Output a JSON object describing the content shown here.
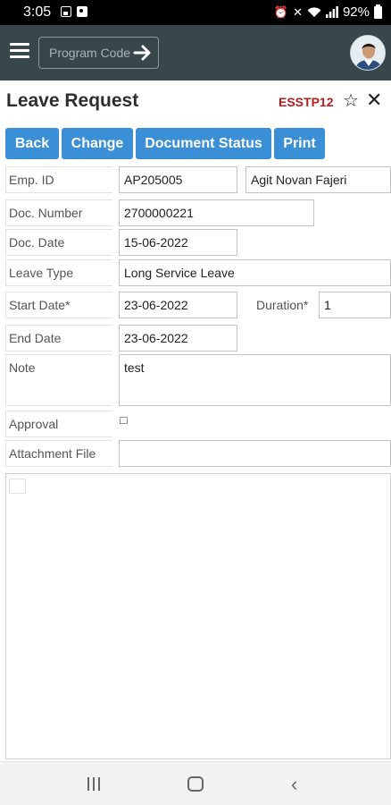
{
  "status_bar": {
    "time": "3:05",
    "battery_pct": "92%",
    "icons": [
      "image-icon",
      "photo-icon",
      "alarm-icon",
      "mute-icon",
      "wifi-icon",
      "signal-icon",
      "battery-icon"
    ]
  },
  "app_bar": {
    "program_code_placeholder": "Program Code",
    "colors": {
      "background": "#37474a"
    }
  },
  "header": {
    "title": "Leave Request",
    "code": "ESSTP12",
    "code_color": "#b71c1c"
  },
  "toolbar": {
    "back": "Back",
    "change": "Change",
    "document_status": "Document Status",
    "print": "Print",
    "button_color": "#3a8fd6"
  },
  "form": {
    "emp_id": {
      "label": "Emp. ID",
      "value": "AP205005",
      "name_value": "Agit Novan Fajeri"
    },
    "doc_number": {
      "label": "Doc. Number",
      "value": "2700000221"
    },
    "doc_date": {
      "label": "Doc. Date",
      "value": "15-06-2022"
    },
    "leave_type": {
      "label": "Leave Type",
      "value": "Long Service Leave"
    },
    "start_date": {
      "label": "Start Date*",
      "value": "23-06-2022"
    },
    "duration": {
      "label": "Duration*",
      "value": "1"
    },
    "end_date": {
      "label": "End Date",
      "value": "23-06-2022"
    },
    "note": {
      "label": "Note",
      "value": "test"
    },
    "approval": {
      "label": "Approval",
      "checked": false
    },
    "attachment": {
      "label": "Attachment File",
      "value": ""
    }
  },
  "nav_bar": {
    "icons": [
      "recent-apps-icon",
      "home-icon",
      "back-icon"
    ]
  }
}
